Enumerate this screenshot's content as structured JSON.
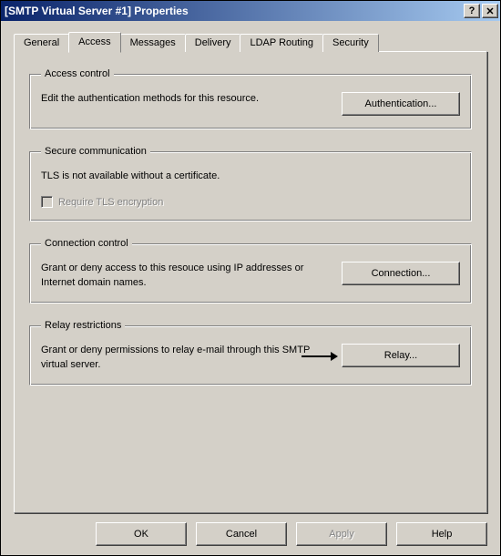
{
  "window": {
    "title": "[SMTP Virtual Server #1] Properties",
    "help_btn": "?",
    "close_btn": "✕"
  },
  "tabs": {
    "general": "General",
    "access": "Access",
    "messages": "Messages",
    "delivery": "Delivery",
    "ldap": "LDAP Routing",
    "security": "Security"
  },
  "groups": {
    "access_control": {
      "legend": "Access control",
      "desc": "Edit the authentication methods for this resource.",
      "button": "Authentication..."
    },
    "secure_comm": {
      "legend": "Secure communication",
      "desc": "TLS is not available without a certificate.",
      "checkbox": "Require TLS encryption"
    },
    "connection_control": {
      "legend": "Connection control",
      "desc": "Grant or deny access to this resouce using IP addresses or Internet domain names.",
      "button": "Connection..."
    },
    "relay": {
      "legend": "Relay restrictions",
      "desc": "Grant or deny permissions to relay e-mail through this SMTP virtual server.",
      "button": "Relay..."
    }
  },
  "dialog_buttons": {
    "ok": "OK",
    "cancel": "Cancel",
    "apply": "Apply",
    "help": "Help"
  }
}
